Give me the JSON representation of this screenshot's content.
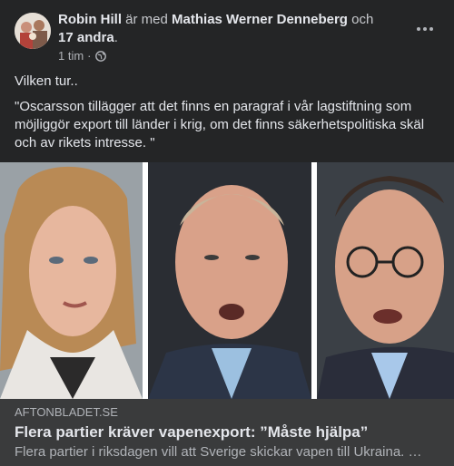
{
  "post": {
    "author": "Robin Hill",
    "with_text": " är med ",
    "tagged": "Mathias Werner Denneberg",
    "and_text": " och ",
    "others": "17 andra",
    "period": ".",
    "time": "1 tim",
    "dot": "·",
    "privacy_icon": "globe-icon",
    "more_icon": "more-options-icon",
    "text_line1": "Vilken tur..",
    "text_quote": "\"Oscarsson tillägger att det finns en paragraf i vår lagstiftning som möjliggör export till länder i krig, om det finns säkerhetspolitiska skäl och av rikets intresse. \""
  },
  "link": {
    "domain": "AFTONBLADET.SE",
    "headline": "Flera partier kräver vapenexport: ”Måste hjälpa”",
    "description": "Flera partier i riksdagen vill att Sverige skickar vapen till Ukraina. …"
  }
}
